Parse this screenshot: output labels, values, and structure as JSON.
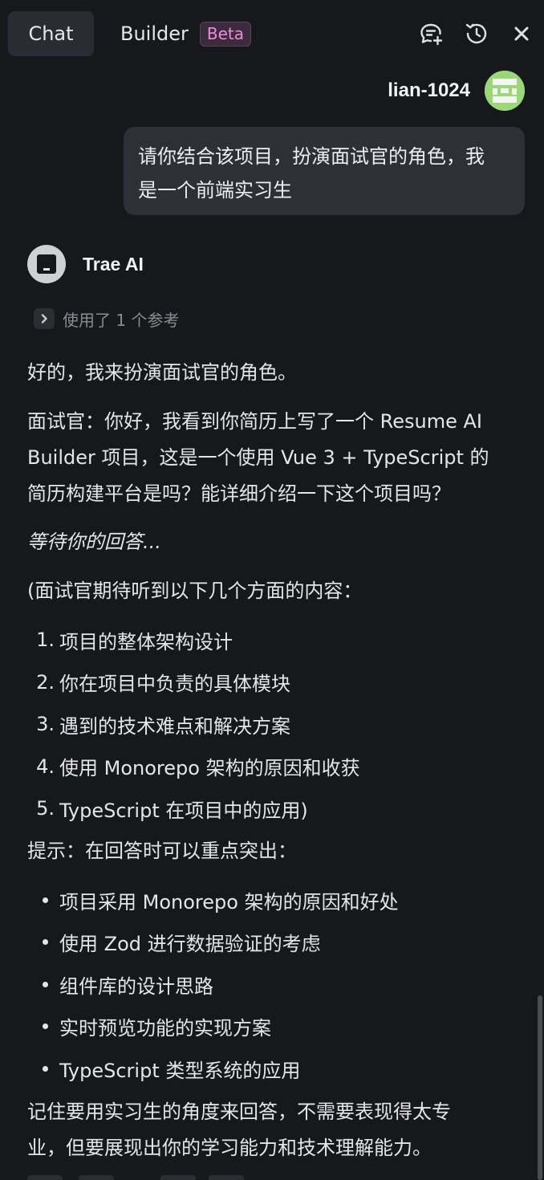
{
  "tabs": {
    "chat": "Chat",
    "builder": "Builder",
    "beta": "Beta"
  },
  "icons": {
    "new_chat": "new-chat-icon",
    "history": "history-icon",
    "close": "close-icon"
  },
  "user": {
    "name": "lian-1024",
    "message_line1": "请你结合该项目，扮演面试官的角色，我",
    "message_line2": "是一个前端实习生"
  },
  "assistant": {
    "name": "Trae AI",
    "reference_label": "使用了 1 个参考",
    "intro": "好的，我来扮演面试官的角色。",
    "question_line1": "面试官：你好，我看到你简历上写了一个 Resume AI",
    "question_line2": "Builder 项目，这是一个使用 Vue 3 + TypeScript 的",
    "question_line3": "简历构建平台是吗？能详细介绍一下这个项目吗？",
    "waiting": "等待你的回答...",
    "expect_intro": "(面试官期待听到以下几个方面的内容：",
    "expect_items": [
      "项目的整体架构设计",
      "你在项目中负责的具体模块",
      "遇到的技术难点和解决方案",
      "使用 Monorepo 架构的原因和收获",
      "TypeScript 在项目中的应用)"
    ],
    "hint_intro": "提示：在回答时可以重点突出：",
    "hint_items": [
      "项目采用 Monorepo 架构的原因和好处",
      "使用 Zod 进行数据验证的考虑",
      "组件库的设计思路",
      "实时预览功能的实现方案",
      "TypeScript 类型系统的应用"
    ],
    "closing_line1": "记住要用实习生的角度来回答，不需要表现得太专",
    "closing_line2": "业，但要展现出你的学习能力和技术理解能力。"
  },
  "colors": {
    "background": "#17181c",
    "bubble": "#2e3038",
    "beta_text": "#f08bd8",
    "avatar_green": "#9bd67a"
  }
}
